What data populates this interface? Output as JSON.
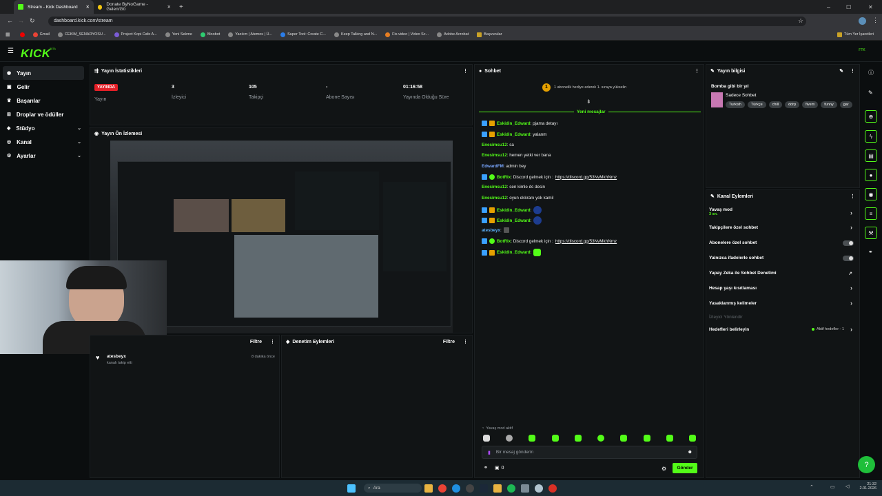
{
  "browser": {
    "tabs": [
      {
        "label": "Stream - Kick Dashboard"
      },
      {
        "label": "Donate ByNoGame - Gelen/Gö"
      }
    ],
    "url": "dashboard.kick.com/stream",
    "bookmarks": [
      "Gmail",
      "CEKIM_SENARYOSU...",
      "Project Kopi Cafe A...",
      "Yeni Sekme",
      "Moobot",
      "Yazılım | Atemos | Ü...",
      "Super Tool: Create C...",
      "Keep Talking and N...",
      "Fix.video | Video Sc...",
      "Adobe Acrobat",
      "Başvurular"
    ],
    "all_bookmarks": "Tüm Yer İşaretleri"
  },
  "app": {
    "logo": "KICK",
    "logo_beta": "BETA",
    "avatar": "FTK"
  },
  "sidebar": {
    "items": [
      {
        "label": "Yayın"
      },
      {
        "label": "Gelir"
      },
      {
        "label": "Başarılar"
      },
      {
        "label": "Droplar ve ödüller"
      },
      {
        "label": "Stüdyo"
      },
      {
        "label": "Kanal"
      },
      {
        "label": "Ayarlar"
      }
    ]
  },
  "stats": {
    "title": "Yayın İstatistikleri",
    "live": "YAYINDA",
    "live_label": "Yayın",
    "viewers": "3",
    "viewers_label": "İzleyici",
    "followers": "105",
    "followers_label": "Takipçi",
    "subs": "-",
    "subs_label": "Abone Sayısı",
    "duration": "01:16:58",
    "duration_label": "Yayında Olduğu Süre"
  },
  "preview": {
    "title": "Yayın Ön İzlemesi"
  },
  "activity": {
    "filter": "Filtre",
    "user": "atesbeyx",
    "action": "kanalı takip etti",
    "time": "8 dakika önce"
  },
  "moderation": {
    "title": "Denetim Eylemleri",
    "filter": "Filtre"
  },
  "chat": {
    "title": "Sohbet",
    "pinned_num": "1",
    "pinned": "1 abonelik hediye ederek 1. sıraya yükselin",
    "new_messages": "Yeni mesajlar",
    "messages": [
      {
        "user": "Eskidin_Edward",
        "text": ": pjama detayı"
      },
      {
        "user": "Eskidin_Edward",
        "text": ": yalanm"
      },
      {
        "user": "Enesimsu12",
        "text": ": sa"
      },
      {
        "user": "Enesimsu12",
        "text": ": hemen yetki ver bana"
      },
      {
        "user": "EdwardFM",
        "text": ": admin bey"
      },
      {
        "user": "BotRix",
        "text": ": Discord gelmek için : ",
        "link": "https://discord.gg/53NvMkhNmz"
      },
      {
        "user": "Enesimsu12",
        "text": ": sen kimle dc desin"
      },
      {
        "user": "Enesimsu12",
        "text": ": oyun ekkranı yok kamil"
      },
      {
        "user": "Eskidin_Edward",
        "text": ":"
      },
      {
        "user": "Eskidin_Edward",
        "text": ":"
      },
      {
        "user": "atesbeyx",
        "text": ":"
      },
      {
        "user": "BotRix",
        "text": ": Discord gelmek için : ",
        "link": "https://discord.gg/53NvMkhNmz"
      },
      {
        "user": "Eskidin_Edward",
        "text": ":"
      }
    ],
    "slow_mode": "Yavaş mod aktif",
    "placeholder": "Bir mesaj gönderin",
    "points": "0",
    "send": "Gönder"
  },
  "stream_info": {
    "title": "Yayın bilgisi",
    "stream_title": "Bomba gibi bir yıl",
    "category": "Sadece Sohbet",
    "tags": [
      "Turkish",
      "Türkçe",
      "chill",
      "ddrp",
      "fivem",
      "funny",
      "gar"
    ]
  },
  "channel_actions": {
    "title": "Kanal Eylemleri",
    "slow_mode": "Yavaş mod",
    "slow_value": "3 sn.",
    "followers_chat": "Takipçilere özel sohbet",
    "subs_chat": "Abonelere özel sohbet",
    "emotes_chat": "Yalnızca ifadelerle sohbet",
    "ai_mod": "Yapay Zeka ile Sohbet Denetimi",
    "age": "Hesap yaşı kısıtlaması",
    "banned_words": "Yasaklanmış kelimeler",
    "viewer_dir": "İzleyici Yönlendir",
    "goals": "Hedefleri belirleyin",
    "goals_status": "Aktif hedefler - 1"
  },
  "taskbar": {
    "search": "Ara",
    "time": "21:32",
    "date": "2.01.2026"
  }
}
